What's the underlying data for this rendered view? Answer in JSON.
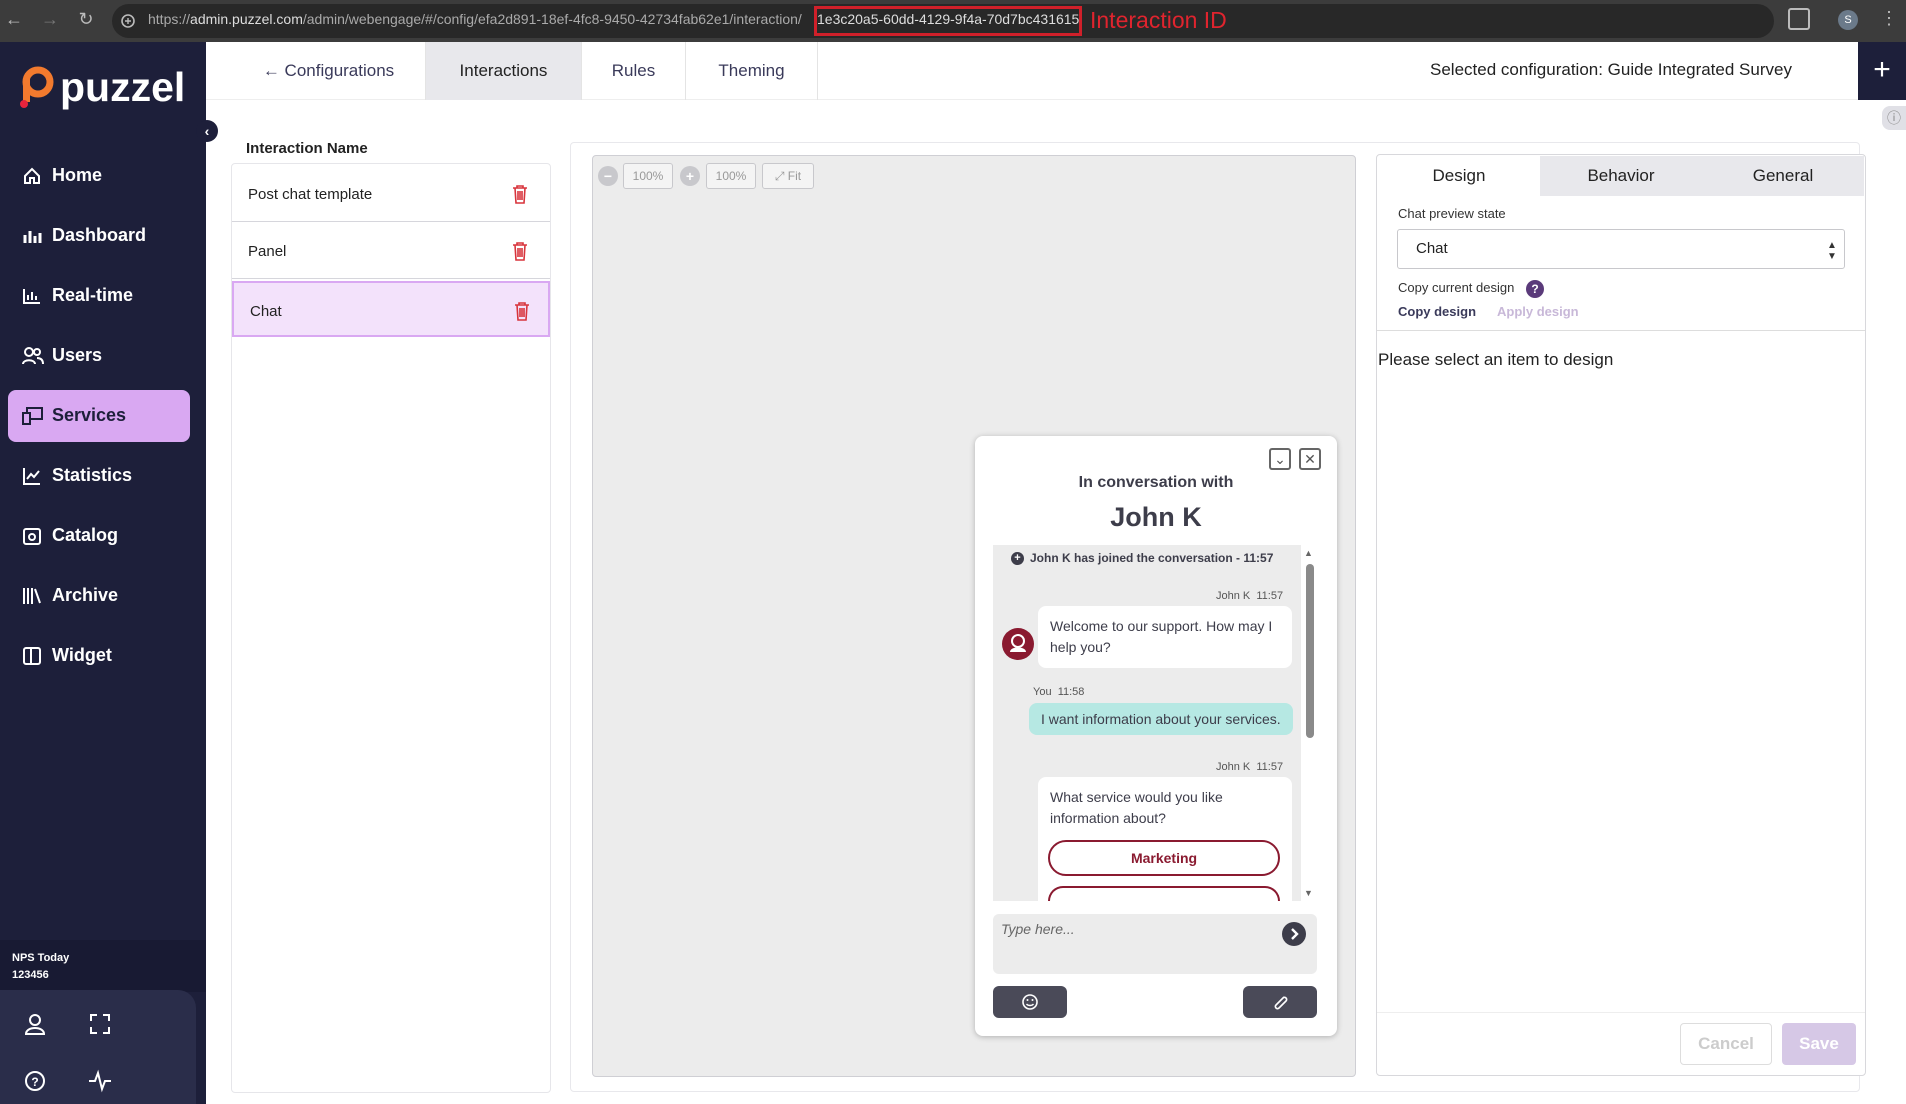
{
  "browser": {
    "url_prefix": "https://",
    "url_host": "admin.puzzel.com",
    "url_path": "/admin/webengage/#/config/efa2d891-18ef-4fc8-9450-42734fab62e1/interaction/",
    "url_highlighted_id": "1e3c20a5-60dd-4129-9f4a-70d7bc431615",
    "annotation_label": "Interaction ID",
    "annotation_color": "#e0242e",
    "profile_initial": "S"
  },
  "sidebar": {
    "logo_text": "puzzel",
    "items": [
      {
        "label": "Home",
        "icon": "home-icon"
      },
      {
        "label": "Dashboard",
        "icon": "dashboard-icon"
      },
      {
        "label": "Real-time",
        "icon": "realtime-icon"
      },
      {
        "label": "Users",
        "icon": "users-icon"
      },
      {
        "label": "Services",
        "icon": "services-icon",
        "active": true
      },
      {
        "label": "Statistics",
        "icon": "statistics-icon"
      },
      {
        "label": "Catalog",
        "icon": "catalog-icon"
      },
      {
        "label": "Archive",
        "icon": "archive-icon"
      },
      {
        "label": "Widget",
        "icon": "widget-icon"
      }
    ],
    "nps_title": "NPS Today",
    "nps_value": "123456",
    "accent_color": "#d9a8f2",
    "bg_color": "#1d1f3a"
  },
  "topbar": {
    "back_label": "Configurations",
    "tabs": [
      "Interactions",
      "Rules",
      "Theming"
    ],
    "active_tab": "Interactions",
    "selected_config": "Selected configuration: Guide Integrated Survey"
  },
  "interactions": {
    "title": "Interaction Name",
    "items": [
      "Post chat template",
      "Panel",
      "Chat"
    ],
    "selected": "Chat"
  },
  "preview": {
    "zoom_value": "100%",
    "zoom_value_2": "100%",
    "fit_label": "Fit",
    "chat": {
      "heading": "In conversation with",
      "agent": "John K",
      "joined_text": "John K has joined the conversation - 11:57",
      "messages": [
        {
          "sender": "John K",
          "time": "11:57",
          "text": "Welcome to our support. How may I help you?"
        },
        {
          "sender": "You",
          "time": "11:58",
          "text": "I want information about your services."
        },
        {
          "sender": "John K",
          "time": "11:57",
          "text": "What service would you like information about?"
        }
      ],
      "option_1": "Marketing",
      "input_placeholder": "Type here...",
      "brand_color": "#8a1a30"
    }
  },
  "design_panel": {
    "tabs": [
      "Design",
      "Behavior",
      "General"
    ],
    "active_tab": "Design",
    "chat_preview_state_label": "Chat preview state",
    "chat_preview_state_value": "Chat",
    "copy_current_label": "Copy current design",
    "copy_design": "Copy design",
    "apply_design": "Apply design",
    "empty_message": "Please select an item to design",
    "cancel": "Cancel",
    "save": "Save"
  }
}
